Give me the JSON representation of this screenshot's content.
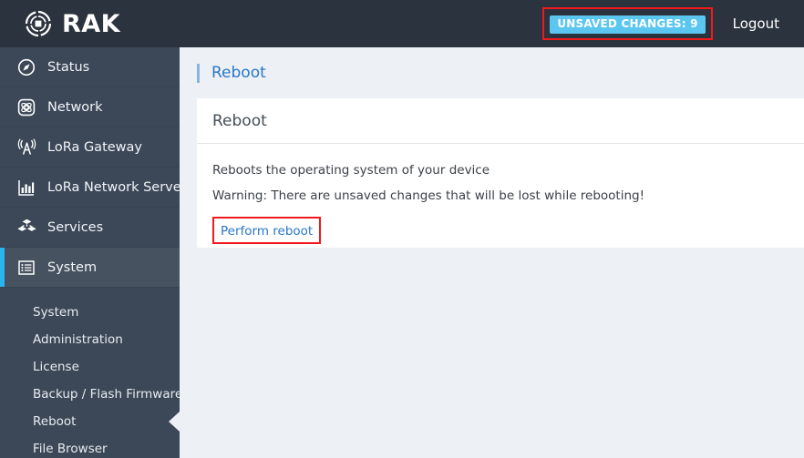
{
  "header": {
    "brand": "RAK",
    "brand_logo_icon": "rak-swirl-logo-icon",
    "unsaved_badge": "UNSAVED CHANGES: 9",
    "logout_label": "Logout",
    "badge_color": "#5bc6f0",
    "annotation_color": "#f2191b",
    "background_color": "#2b333e"
  },
  "sidebar": {
    "background_color": "#3c4858",
    "active_accent_color": "#29b6f0",
    "items": [
      {
        "label": "Status",
        "icon": "compass-icon",
        "active": false
      },
      {
        "label": "Network",
        "icon": "atom-network-icon",
        "active": false
      },
      {
        "label": "LoRa Gateway",
        "icon": "antenna-tower-icon",
        "active": false
      },
      {
        "label": "LoRa Network Server",
        "icon": "bar-chart-icon",
        "active": false
      },
      {
        "label": "Services",
        "icon": "server-boxes-icon",
        "active": false
      },
      {
        "label": "System",
        "icon": "list-window-icon",
        "active": true
      }
    ],
    "submenu": [
      {
        "label": "System",
        "active": false
      },
      {
        "label": "Administration",
        "active": false
      },
      {
        "label": "License",
        "active": false
      },
      {
        "label": "Backup / Flash Firmware",
        "active": false
      },
      {
        "label": "Reboot",
        "active": true
      },
      {
        "label": "File Browser",
        "active": false
      }
    ]
  },
  "content": {
    "breadcrumb": "Reboot",
    "breadcrumb_color": "#2878c8",
    "card_title": "Reboot",
    "description": "Reboots the operating system of your device",
    "warning": "Warning: There are unsaved changes that will be lost while rebooting!",
    "perform_button": "Perform reboot"
  }
}
